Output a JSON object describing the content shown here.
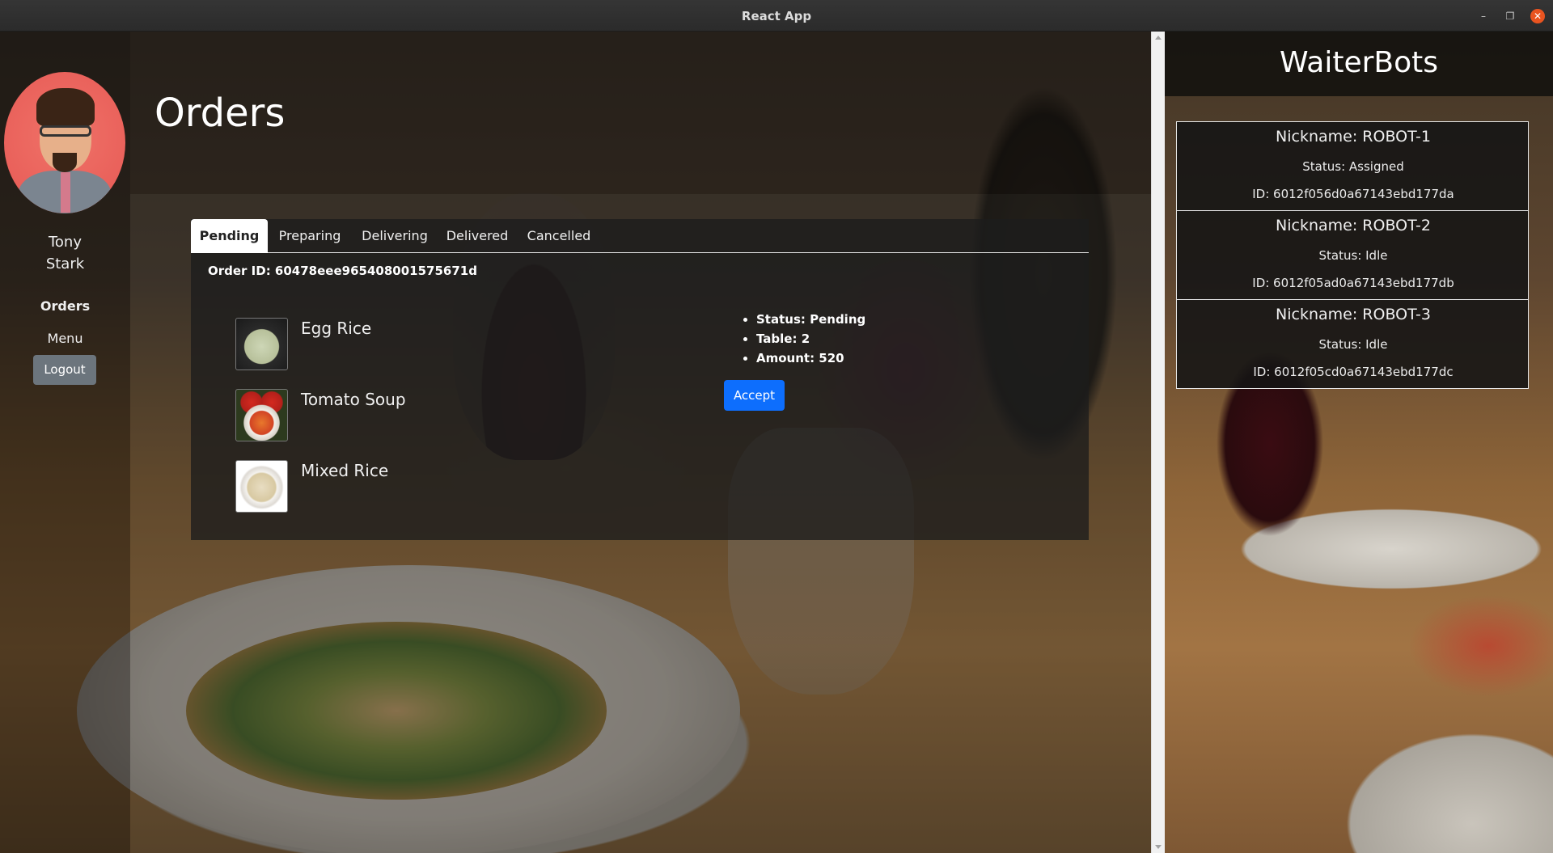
{
  "window": {
    "title": "React App"
  },
  "sidebar": {
    "user_first": "Tony",
    "user_last": "Stark",
    "nav": {
      "orders": "Orders",
      "menu": "Menu"
    },
    "logout": "Logout"
  },
  "main": {
    "title": "Orders",
    "tabs": [
      "Pending",
      "Preparing",
      "Delivering",
      "Delivered",
      "Cancelled"
    ],
    "active_tab": "Pending",
    "order": {
      "id_text": "Order ID: 60478eee965408001575671d",
      "items": [
        "Egg Rice",
        "Tomato Soup",
        "Mixed Rice"
      ],
      "status": "Status: Pending",
      "table": "Table: 2",
      "amount": "Amount: 520",
      "accept_label": "Accept"
    }
  },
  "waiterbots": {
    "title": "WaiterBots",
    "robots": [
      {
        "nickname": "Nickname: ROBOT-1",
        "status": "Status: Assigned",
        "id": "ID: 6012f056d0a67143ebd177da"
      },
      {
        "nickname": "Nickname: ROBOT-2",
        "status": "Status: Idle",
        "id": "ID: 6012f05ad0a67143ebd177db"
      },
      {
        "nickname": "Nickname: ROBOT-3",
        "status": "Status: Idle",
        "id": "ID: 6012f05cd0a67143ebd177dc"
      }
    ]
  },
  "colors": {
    "accent_primary": "#0d6efd",
    "secondary_button": "#6c757d",
    "window_close": "#e95420"
  },
  "icons": {
    "minimize": "minimize-icon",
    "maximize": "maximize-icon",
    "close": "close-icon",
    "scroll_up": "scroll-up-arrow-icon",
    "scroll_down": "scroll-down-arrow-icon"
  }
}
